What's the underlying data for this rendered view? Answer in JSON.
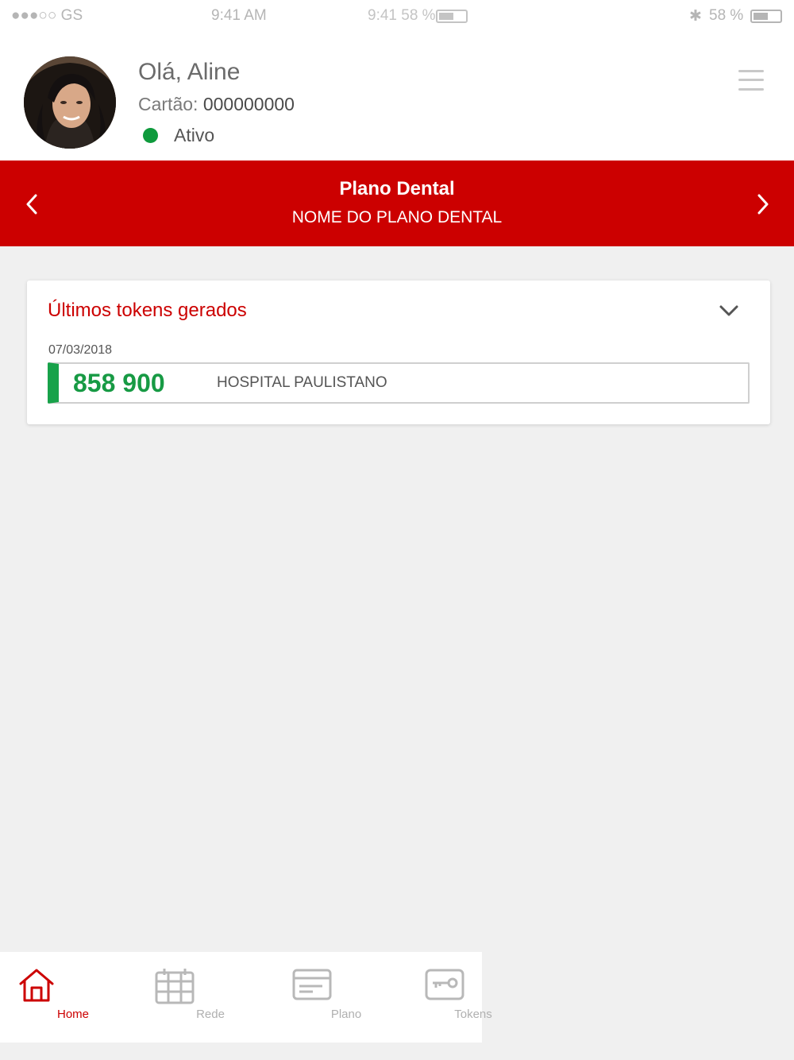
{
  "status_bar": {
    "carrier": "●●●○○ GS",
    "time": "9:41 AM",
    "ghost_text": "9:41 58 %",
    "bluetooth_glyph": "✱",
    "battery_text": "58 %"
  },
  "profile": {
    "greeting": "Olá, Aline",
    "card_label": "Cartão:",
    "card_number": "000000000",
    "status": "Ativo",
    "status_color": "#0e9a3c"
  },
  "plan": {
    "title": "Plano Dental",
    "name": "NOME DO PLANO DENTAL",
    "color": "#cc0000"
  },
  "tokens_card": {
    "title": "Últimos tokens gerados",
    "items": [
      {
        "date": "07/03/2018",
        "code": "858 900",
        "place": "HOSPITAL PAULISTANO"
      }
    ]
  },
  "tabbar": {
    "items": [
      {
        "label": "Home",
        "icon": "home-icon",
        "active": true
      },
      {
        "label": "Rede",
        "icon": "calendar-grid-icon",
        "active": false
      },
      {
        "label": "Plano",
        "icon": "card-icon",
        "active": false
      },
      {
        "label": "Tokens",
        "icon": "key-icon",
        "active": false
      }
    ]
  }
}
